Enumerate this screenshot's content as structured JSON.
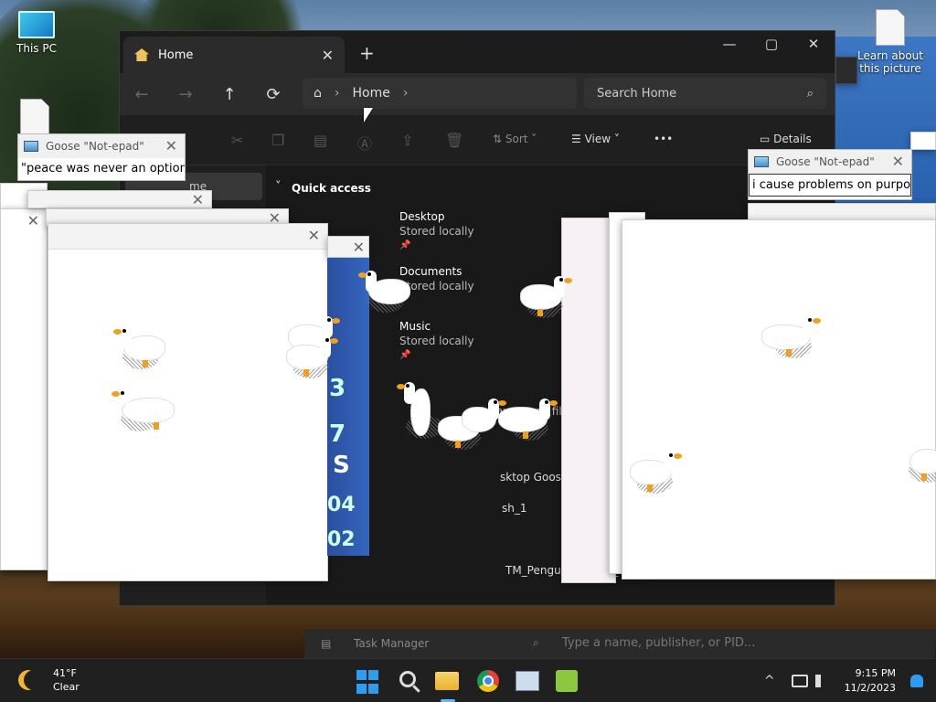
{
  "desktop": {
    "icons": [
      {
        "label": "This PC"
      },
      {
        "label": "Learn about this picture"
      }
    ]
  },
  "explorer": {
    "tab_label": "Home",
    "new_tab": "+",
    "window_buttons": [
      "—",
      "▢",
      "✕"
    ],
    "breadcrumb": [
      "Home"
    ],
    "search_placeholder": "Search Home",
    "command_bar": {
      "sort_label": "Sort",
      "view_label": "View",
      "more_label": "•••",
      "details_label": "Details"
    },
    "sidebar_selected": "me",
    "quick_access_title": "Quick access",
    "quick_access": [
      {
        "name": "Desktop",
        "sub": "Stored locally"
      },
      {
        "name": "Documents",
        "sub": "Stored locally"
      },
      {
        "name": "Music",
        "sub": "Stored locally"
      }
    ],
    "recent_hint": "avor    ome files, we'll sh",
    "recent": [
      "sktop Goose v0.31",
      "sh_1",
      "TM_Penguin_UK_DK_AL64464..."
    ]
  },
  "notepads": [
    {
      "title": "Goose \"Not-epad\"",
      "text": "\"peace was never an option\""
    },
    {
      "title": "Goose \"Not-epad\"",
      "text": "i cause problems on purpose"
    }
  ],
  "ie_numbers": [
    "3",
    "7",
    "S",
    "04",
    "02"
  ],
  "task_manager": {
    "title": "Task Manager",
    "search_placeholder": "Type a name, publisher, or PID..."
  },
  "taskbar": {
    "weather_temp": "41°F",
    "weather_cond": "Clear",
    "time": "9:15 PM",
    "date": "11/2/2023",
    "tray_chevron": "^"
  },
  "colors": {
    "accent": "#2e9cf0",
    "explorer_bg": "#202020",
    "goose_beak": "#f0a020"
  }
}
